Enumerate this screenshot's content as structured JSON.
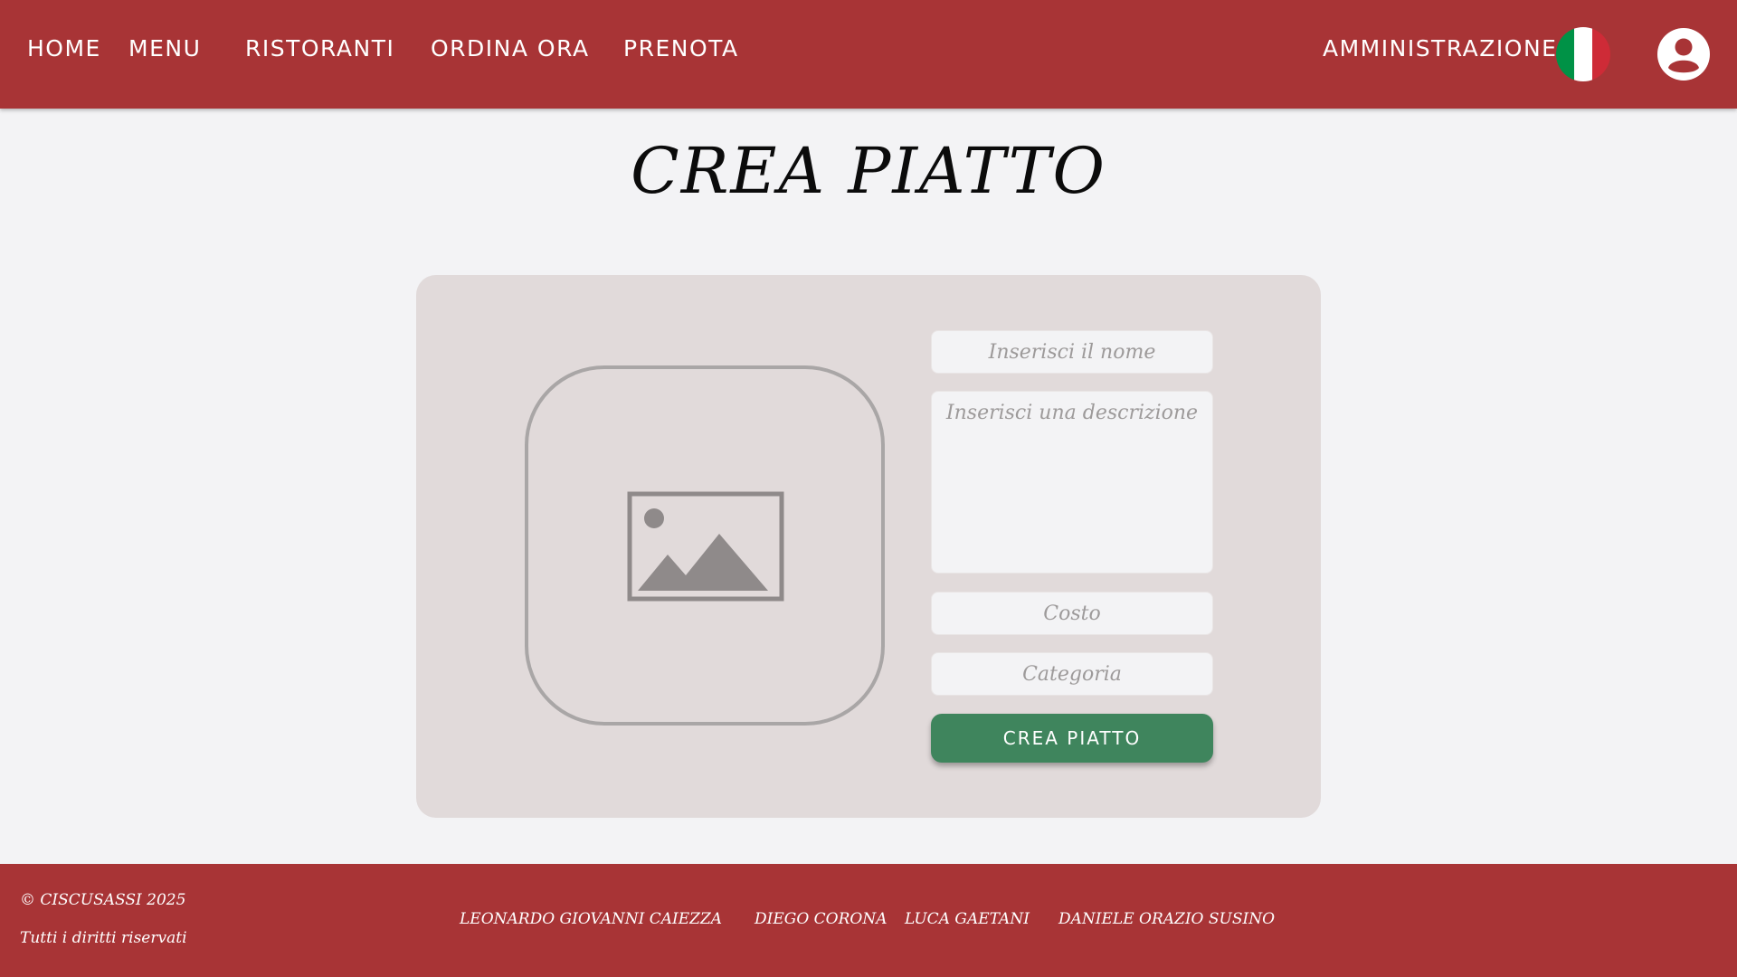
{
  "header": {
    "nav": [
      {
        "label": "HOME"
      },
      {
        "label": "MENU"
      },
      {
        "label": "RISTORANTI"
      },
      {
        "label": "ORDINA ORA"
      },
      {
        "label": "PRENOTA"
      }
    ],
    "admin_label": "AMMINISTRAZIONE",
    "language_icon": "italy-flag-icon",
    "user_icon": "user-account-icon",
    "colors": {
      "bar": "#a83436",
      "flag_green": "#009246",
      "flag_white": "#ffffff",
      "flag_red": "#ce2b37"
    }
  },
  "page": {
    "title": "CREA PIATTO"
  },
  "form": {
    "image_icon": "image-placeholder-icon",
    "name_placeholder": "Inserisci il nome",
    "description_placeholder": "Inserisci una descrizione",
    "cost_placeholder": "Costo",
    "category_placeholder": "Categoria",
    "submit_label": "CREA PIATTO",
    "colors": {
      "card": "#e1dada",
      "button": "#3f855d"
    }
  },
  "footer": {
    "copyright": "© CISCUSASSI 2025",
    "rights": "Tutti i diritti riservati",
    "authors": [
      "LEONARDO GIOVANNI CAIEZZA",
      "DIEGO CORONA",
      "LUCA GAETANI",
      "DANIELE ORAZIO SUSINO"
    ]
  }
}
